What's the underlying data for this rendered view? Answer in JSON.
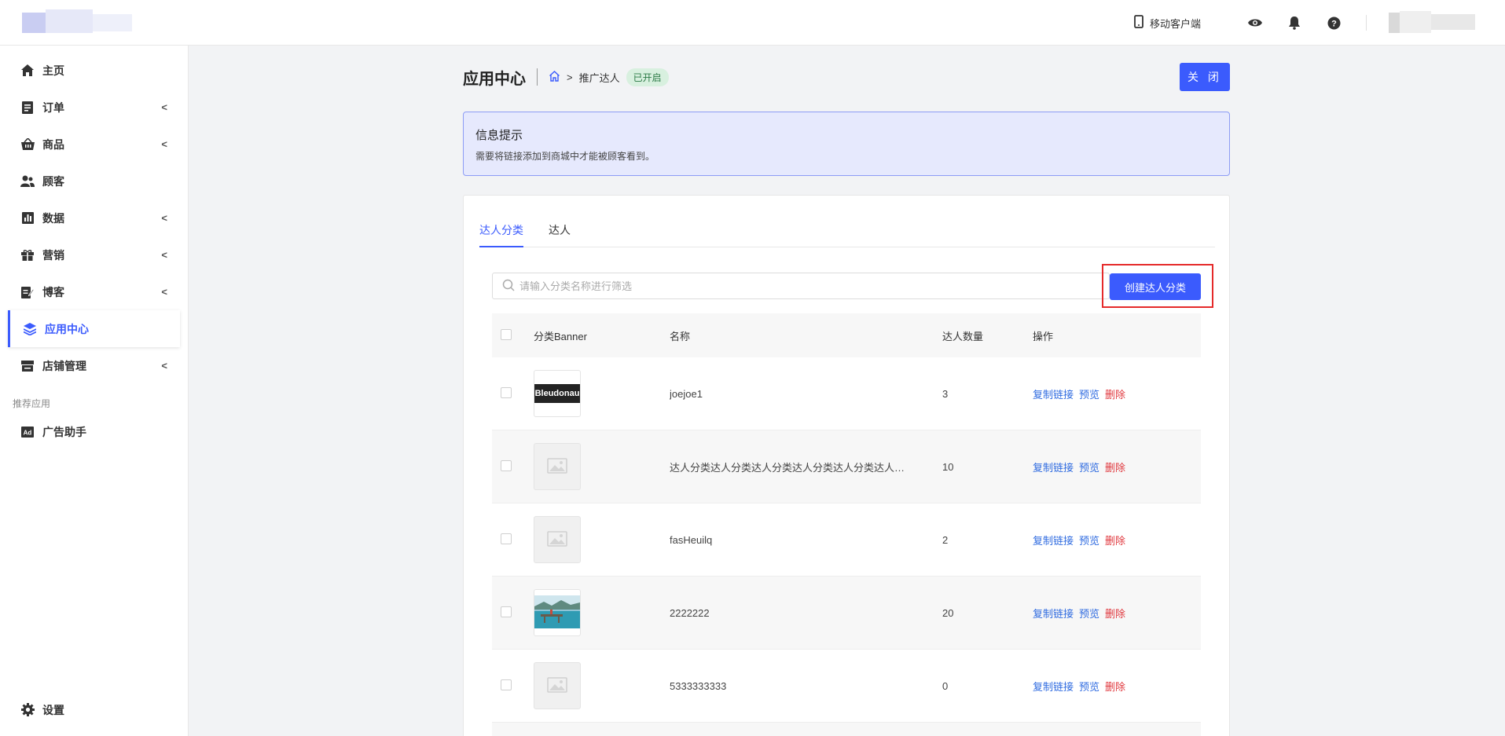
{
  "topbar": {
    "mobile_client_label": "移动客户端"
  },
  "sidebar": {
    "items": [
      {
        "label": "主页",
        "icon": "home-icon",
        "has_chevron": false
      },
      {
        "label": "订单",
        "icon": "order-icon",
        "has_chevron": true
      },
      {
        "label": "商品",
        "icon": "basket-icon",
        "has_chevron": true
      },
      {
        "label": "顾客",
        "icon": "users-icon",
        "has_chevron": false
      },
      {
        "label": "数据",
        "icon": "chart-icon",
        "has_chevron": true
      },
      {
        "label": "营销",
        "icon": "gift-icon",
        "has_chevron": true
      },
      {
        "label": "博客",
        "icon": "edit-icon",
        "has_chevron": true
      },
      {
        "label": "应用中心",
        "icon": "layers-icon",
        "has_chevron": false,
        "active": true
      },
      {
        "label": "店铺管理",
        "icon": "store-icon",
        "has_chevron": true
      }
    ],
    "section_label": "推荐应用",
    "recommended": [
      {
        "label": "广告助手",
        "icon": "ad-icon"
      }
    ],
    "settings_label": "设置",
    "chevron": "<"
  },
  "header": {
    "title": "应用中心",
    "breadcrumb_sep": ">",
    "breadcrumb_current": "推广达人",
    "status_badge": "已开启",
    "close_label": "关 闭"
  },
  "info": {
    "title": "信息提示",
    "text": "需要将链接添加到商城中才能被顾客看到。"
  },
  "tabs": [
    {
      "label": "达人分类",
      "active": true
    },
    {
      "label": "达人",
      "active": false
    }
  ],
  "search": {
    "placeholder": "请输入分类名称进行筛选"
  },
  "create_button_label": "创建达人分类",
  "table": {
    "headers": {
      "banner": "分类Banner",
      "name": "名称",
      "count": "达人数量",
      "ops": "操作"
    },
    "ops_labels": {
      "copy": "复制链接",
      "preview": "预览",
      "delete": "删除"
    },
    "rows": [
      {
        "banner": "logo",
        "banner_text": "Bleudonau",
        "name": "joejoe1",
        "count": "3"
      },
      {
        "banner": "placeholder",
        "name": "达人分类达人分类达人分类达人分类达人分类达人分类达人分类",
        "count": "10"
      },
      {
        "banner": "placeholder",
        "name": "fasHeuilq",
        "count": "2"
      },
      {
        "banner": "photo",
        "name": "2222222",
        "count": "20"
      },
      {
        "banner": "placeholder",
        "name": "5333333333",
        "count": "0"
      }
    ]
  },
  "colors": {
    "accent": "#3b5bfd",
    "info_bg": "#e6e9fd",
    "badge_bg": "#d8f0df",
    "delete": "#e0383e",
    "link": "#2f6be0",
    "highlight_border": "#e52a2a"
  }
}
